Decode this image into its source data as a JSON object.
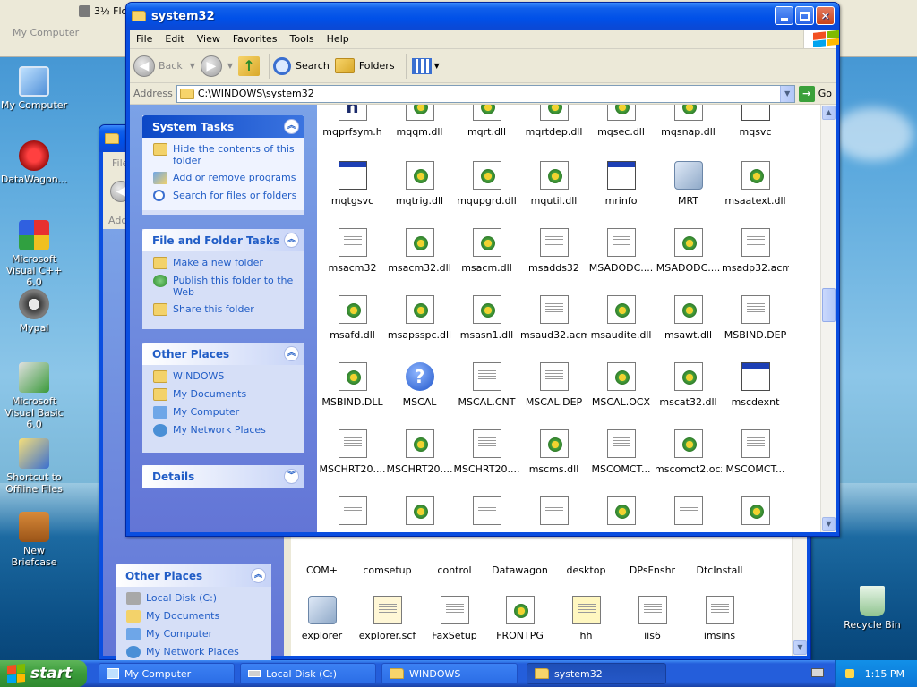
{
  "desktop": {
    "icons": [
      {
        "label": "My Computer"
      },
      {
        "label": "DataWagon..."
      },
      {
        "label": "Microsoft Visual C++ 6.0"
      },
      {
        "label": "Mypal"
      },
      {
        "label": "Microsoft Visual Basic 6.0"
      },
      {
        "label": "Shortcut to Offline Files"
      },
      {
        "label": "New Briefcase"
      },
      {
        "label": "Recycle Bin"
      }
    ]
  },
  "bg_window": {
    "title": "My Computer",
    "drive": "3½ Flo"
  },
  "mid_window": {
    "menu_partial": "File",
    "addr_partial": "Addr",
    "other_places": {
      "title": "Other Places",
      "links": [
        "Local Disk (C:)",
        "My Documents",
        "My Computer",
        "My Network Places"
      ]
    },
    "row1": [
      "COM+",
      "comsetup",
      "control",
      "Datawagon",
      "desktop",
      "DPsFnshr",
      "DtcInstall"
    ],
    "row2": [
      "explorer",
      "explorer.scf",
      "FaxSetup",
      "FRONTPG",
      "hh",
      "iis6",
      "imsins"
    ]
  },
  "window": {
    "title": "system32",
    "menu": [
      "File",
      "Edit",
      "View",
      "Favorites",
      "Tools",
      "Help"
    ],
    "toolbar": {
      "back": "Back",
      "search": "Search",
      "folders": "Folders"
    },
    "address": {
      "label": "Address",
      "value": "C:\\WINDOWS\\system32",
      "go": "Go"
    }
  },
  "taskpane": {
    "system_tasks": {
      "title": "System Tasks",
      "links": [
        "Hide the contents of this folder",
        "Add or remove programs",
        "Search for files or folders"
      ]
    },
    "file_folder_tasks": {
      "title": "File and Folder Tasks",
      "links": [
        "Make a new folder",
        "Publish this folder to the Web",
        "Share this folder"
      ]
    },
    "other_places": {
      "title": "Other Places",
      "links": [
        "WINDOWS",
        "My Documents",
        "My Computer",
        "My Network Places"
      ]
    },
    "details": {
      "title": "Details"
    }
  },
  "files": [
    [
      "mqprfsym.h",
      "mqqm.dll",
      "mqrt.dll",
      "mqrtdep.dll",
      "mqsec.dll",
      "mqsnap.dll",
      "mqsvc"
    ],
    [
      "mqtgsvc",
      "mqtrig.dll",
      "mqupgrd.dll",
      "mqutil.dll",
      "mrinfo",
      "MRT",
      "msaatext.dll"
    ],
    [
      "msacm32",
      "msacm32.dll",
      "msacm.dll",
      "msadds32",
      "MSADODC....",
      "MSADODC....",
      "msadp32.acm"
    ],
    [
      "msafd.dll",
      "msapsspc.dll",
      "msasn1.dll",
      "msaud32.acm",
      "msaudite.dll",
      "msawt.dll",
      "MSBIND.DEP"
    ],
    [
      "MSBIND.DLL",
      "MSCAL",
      "MSCAL.CNT",
      "MSCAL.DEP",
      "MSCAL.OCX",
      "mscat32.dll",
      "mscdexnt"
    ],
    [
      "MSCHRT20....",
      "MSCHRT20....",
      "MSCHRT20....",
      "mscms.dll",
      "MSCOMCT...",
      "mscomct2.ocx",
      "MSCOMCT..."
    ],
    [
      "",
      "",
      "",
      "",
      "",
      "",
      ""
    ]
  ],
  "file_types": [
    [
      "h",
      "dll",
      "dll",
      "dll",
      "dll",
      "dll",
      "exe-blank"
    ],
    [
      "exe",
      "dll",
      "dll",
      "dll",
      "exe",
      "mrt",
      "dll"
    ],
    [
      "doc",
      "dll",
      "dll",
      "doc",
      "doc",
      "dll",
      "doc"
    ],
    [
      "dll",
      "dll",
      "dll",
      "doc",
      "dll",
      "dll",
      "doc"
    ],
    [
      "dll",
      "help",
      "doc",
      "doc",
      "dll",
      "dll",
      "exe"
    ],
    [
      "doc",
      "dll",
      "doc",
      "dll",
      "doc",
      "dll",
      "doc"
    ],
    [
      "doc",
      "dll",
      "doc",
      "doc",
      "dll",
      "doc",
      "dll"
    ]
  ],
  "taskbar": {
    "start": "start",
    "buttons": [
      "My Computer",
      "Local Disk (C:)",
      "WINDOWS",
      "system32"
    ],
    "clock": "1:15 PM"
  }
}
